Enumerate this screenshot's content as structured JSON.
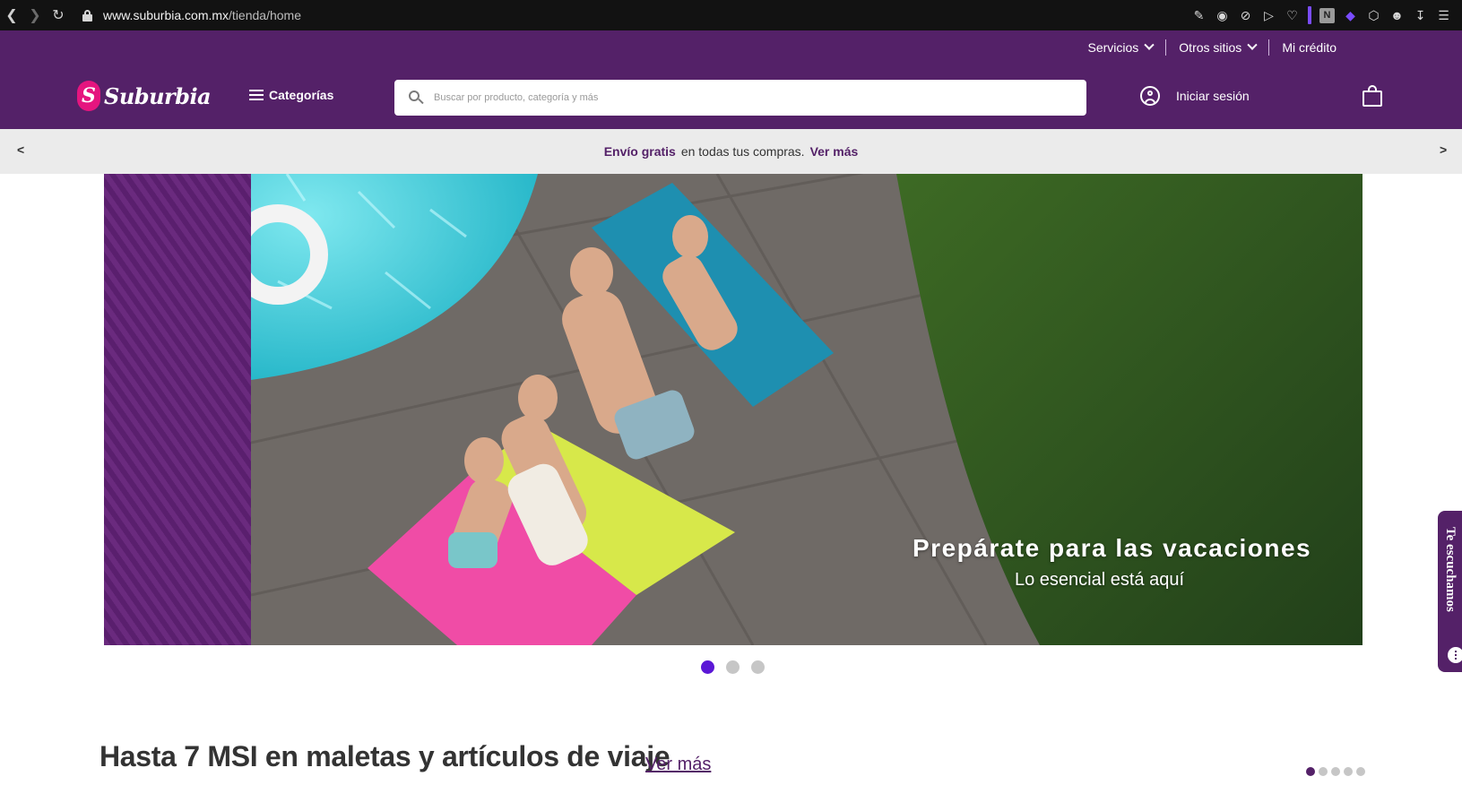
{
  "browser": {
    "url_domain": "www.suburbia.com.mx",
    "url_path": "/tienda/home"
  },
  "utility_nav": {
    "servicios": "Servicios",
    "otros_sitios": "Otros sitios",
    "mi_credito": "Mi crédito"
  },
  "header": {
    "logo_letter": "S",
    "logo_text": "Suburbia",
    "categorias": "Categorías",
    "search_placeholder": "Buscar por producto, categoría y más",
    "login": "Iniciar sesión"
  },
  "promo": {
    "prev": "<",
    "next": ">",
    "strong": "Envío gratis",
    "text": "en todas tus compras.",
    "link": "Ver más"
  },
  "hero": {
    "title": "Prepárate para las vacaciones",
    "subtitle": "Lo esencial está aquí",
    "slides": 3,
    "active_slide": 1
  },
  "feedback": {
    "label": "Te escuchamos"
  },
  "section": {
    "title": "Hasta 7 MSI en maletas y artículos de viaje",
    "link": "Ver más",
    "pages": 5,
    "active_page": 1
  },
  "colors": {
    "brand_purple": "#542168",
    "brand_pink": "#e5157f",
    "active_dot": "#5b17d6",
    "promo_bg": "#ebebeb"
  }
}
